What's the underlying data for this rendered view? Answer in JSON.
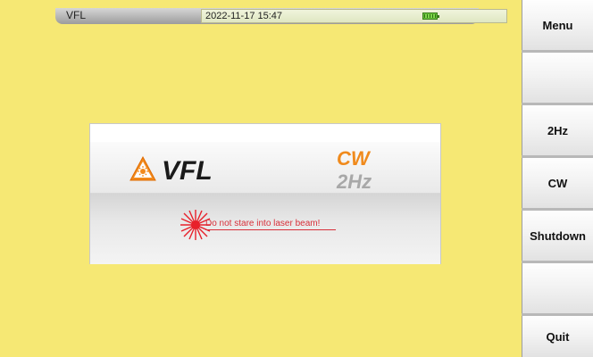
{
  "statusbar": {
    "title": "VFL",
    "datetime": "2022-11-17 15:47"
  },
  "panel": {
    "name": "VFL",
    "mode_active": "CW",
    "mode_inactive": "2Hz",
    "warning": "Do not stare into laser beam!"
  },
  "softkeys": [
    {
      "label": "Menu"
    },
    {
      "label": ""
    },
    {
      "label": "2Hz"
    },
    {
      "label": "CW"
    },
    {
      "label": "Shutdown"
    },
    {
      "label": ""
    },
    {
      "label": "Quit"
    }
  ],
  "colors": {
    "background": "#f6e874",
    "active_mode": "#f08a1c",
    "inactive_mode": "#a8a8a8",
    "warning": "#d8303a"
  }
}
